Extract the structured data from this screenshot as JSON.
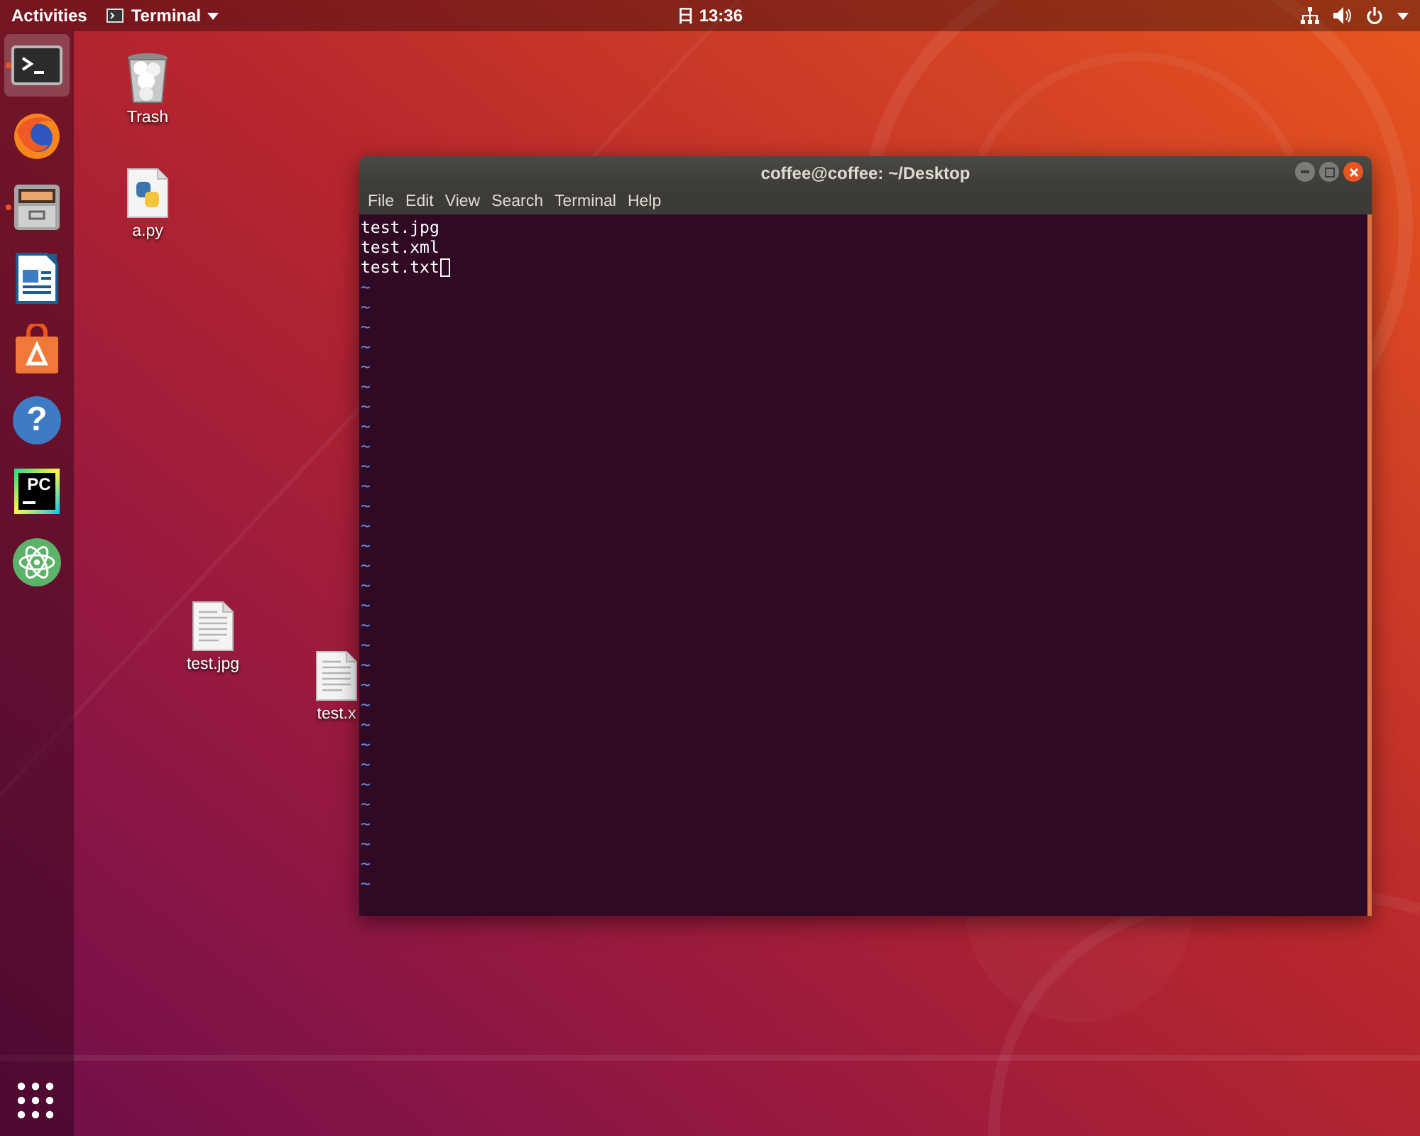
{
  "top_bar": {
    "activities": "Activities",
    "app_menu": "Terminal",
    "clock": "日 13:36"
  },
  "dock": {
    "items": [
      {
        "kind": "terminal",
        "selected": true,
        "running": true
      },
      {
        "kind": "browser",
        "selected": false,
        "running": false
      },
      {
        "kind": "files",
        "selected": false,
        "running": true
      },
      {
        "kind": "writer",
        "selected": false,
        "running": false
      },
      {
        "kind": "software",
        "selected": false,
        "running": false
      },
      {
        "kind": "help",
        "glyph": "?",
        "selected": false,
        "running": false
      },
      {
        "kind": "pycharm",
        "glyph": "PC",
        "selected": false,
        "running": false
      },
      {
        "kind": "atom",
        "selected": false,
        "running": false
      }
    ]
  },
  "desktop_icons": [
    {
      "kind": "trash",
      "label": "Trash"
    },
    {
      "kind": "python",
      "label": "a.py"
    },
    {
      "kind": "document",
      "label": "test.jpg"
    },
    {
      "kind": "document",
      "label": "test.x"
    }
  ],
  "terminal": {
    "title": "coffee@coffee: ~/Desktop",
    "menu": [
      "File",
      "Edit",
      "View",
      "Search",
      "Terminal",
      "Help"
    ],
    "lines": [
      {
        "text": "test.jpg",
        "cursor": false
      },
      {
        "text": "test.xml",
        "cursor": false
      },
      {
        "text": "test.txt",
        "cursor": true
      }
    ],
    "filler_lines": [
      "~",
      "~",
      "~",
      "~",
      "~",
      "~",
      "~",
      "~",
      "~",
      "~",
      "~",
      "~",
      "~",
      "~",
      "~",
      "~",
      "~",
      "~",
      "~",
      "~",
      "~",
      "~",
      "~",
      "~",
      "~",
      "~",
      "~",
      "~",
      "~",
      "~",
      "~"
    ]
  }
}
